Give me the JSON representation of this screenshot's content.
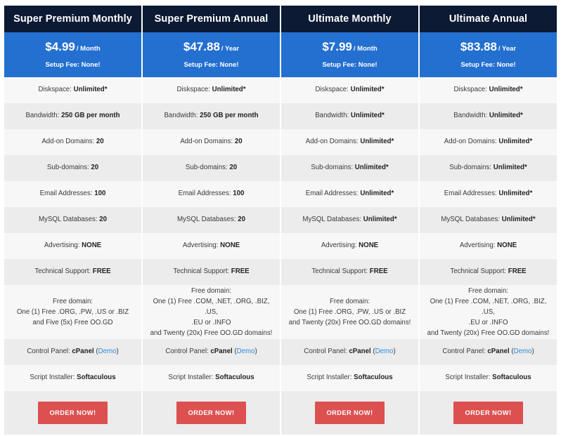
{
  "plans": [
    {
      "name": "Super Premium Monthly",
      "price_amount": "$4.99",
      "price_period": "/ Month",
      "setup_fee": "Setup Fee: None!",
      "order_label": "ORDER NOW!"
    },
    {
      "name": "Super Premium Annual",
      "price_amount": "$47.88",
      "price_period": "/ Year",
      "setup_fee": "Setup Fee: None!",
      "order_label": "ORDER NOW!"
    },
    {
      "name": "Ultimate Monthly",
      "price_amount": "$7.99",
      "price_period": "/ Month",
      "setup_fee": "Setup Fee: None!",
      "order_label": "ORDER NOW!"
    },
    {
      "name": "Ultimate Annual",
      "price_amount": "$83.88",
      "price_period": "/ Year",
      "setup_fee": "Setup Fee: None!",
      "order_label": "ORDER NOW!"
    }
  ],
  "features": [
    {
      "key": "diskspace",
      "label": "Diskspace:",
      "values": [
        "Unlimited*",
        "Unlimited*",
        "Unlimited*",
        "Unlimited*"
      ]
    },
    {
      "key": "bandwidth",
      "label": "Bandwidth:",
      "values": [
        "250 GB per month",
        "250 GB per month",
        "Unlimited*",
        "Unlimited*"
      ]
    },
    {
      "key": "addon-domains",
      "label": "Add-on Domains:",
      "values": [
        "20",
        "20",
        "Unlimited*",
        "Unlimited*"
      ]
    },
    {
      "key": "sub-domains",
      "label": "Sub-domains:",
      "values": [
        "20",
        "20",
        "Unlimited*",
        "Unlimited*"
      ]
    },
    {
      "key": "email-addresses",
      "label": "Email Addresses:",
      "values": [
        "100",
        "100",
        "Unlimited*",
        "Unlimited*"
      ]
    },
    {
      "key": "mysql-databases",
      "label": "MySQL Databases:",
      "values": [
        "20",
        "20",
        "Unlimited*",
        "Unlimited*"
      ]
    },
    {
      "key": "advertising",
      "label": "Advertising:",
      "values": [
        "NONE",
        "NONE",
        "NONE",
        "NONE"
      ]
    },
    {
      "key": "technical-support",
      "label": "Technical Support:",
      "values": [
        "FREE",
        "FREE",
        "FREE",
        "FREE"
      ]
    }
  ],
  "free_domain": {
    "title": "Free domain:",
    "columns": [
      {
        "lines": [
          "One (1) Free .ORG, .PW, .US or .BIZ",
          "and Five (5x) Free OO.GD"
        ]
      },
      {
        "lines": [
          "One (1) Free .COM, .NET, .ORG, .BIZ, .US,",
          ".EU or .INFO",
          "and Twenty (20x) Free OO.GD domains!"
        ]
      },
      {
        "lines": [
          "One (1) Free .ORG, .PW, .US or .BIZ",
          "and Twenty (20x) Free OO.GD domains!"
        ]
      },
      {
        "lines": [
          "One (1) Free .COM, .NET, .ORG, .BIZ, .US,",
          ".EU or .INFO",
          "and Twenty (20x) Free OO.GD domains!"
        ]
      }
    ]
  },
  "control_panel": {
    "label": "Control Panel:",
    "value": "cPanel",
    "demo_open": "(",
    "demo_label": "Demo",
    "demo_close": ")"
  },
  "script_installer": {
    "label": "Script Installer:",
    "value": "Softaculous"
  },
  "colors": {
    "header_bg": "#0c1a33",
    "price_bg": "#2470d0",
    "row_light": "#f7f7f7",
    "row_dark": "#ececec",
    "order_button": "#dd5050",
    "demo_link": "#2e8bdb"
  }
}
